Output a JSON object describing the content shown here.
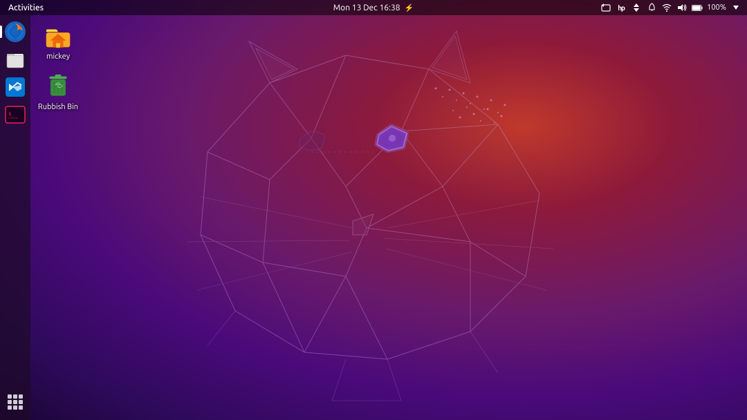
{
  "topbar": {
    "activities_label": "Activities",
    "datetime": "Mon 13 Dec  16:38",
    "lightning_symbol": "⚡",
    "tray": {
      "camera_icon": "camera-icon",
      "hp_icon": "hp-icon",
      "arrows_icon": "arrows-icon",
      "notification_icon": "notification-icon",
      "wifi_icon": "wifi-icon",
      "sound_icon": "sound-icon",
      "battery_label": "100%",
      "battery_icon": "battery-icon",
      "power_icon": "power-icon"
    }
  },
  "dock": {
    "items": [
      {
        "id": "firefox",
        "label": "Firefox",
        "active": true
      },
      {
        "id": "files",
        "label": "Files",
        "active": false
      },
      {
        "id": "vscode",
        "label": "Visual Studio Code",
        "active": false
      },
      {
        "id": "terminal",
        "label": "Terminal",
        "active": false
      }
    ],
    "show_apps_label": "Show Applications"
  },
  "desktop": {
    "icons": [
      {
        "id": "home",
        "label": "mickey",
        "type": "home"
      },
      {
        "id": "trash",
        "label": "Rubbish Bin",
        "type": "trash"
      }
    ]
  }
}
